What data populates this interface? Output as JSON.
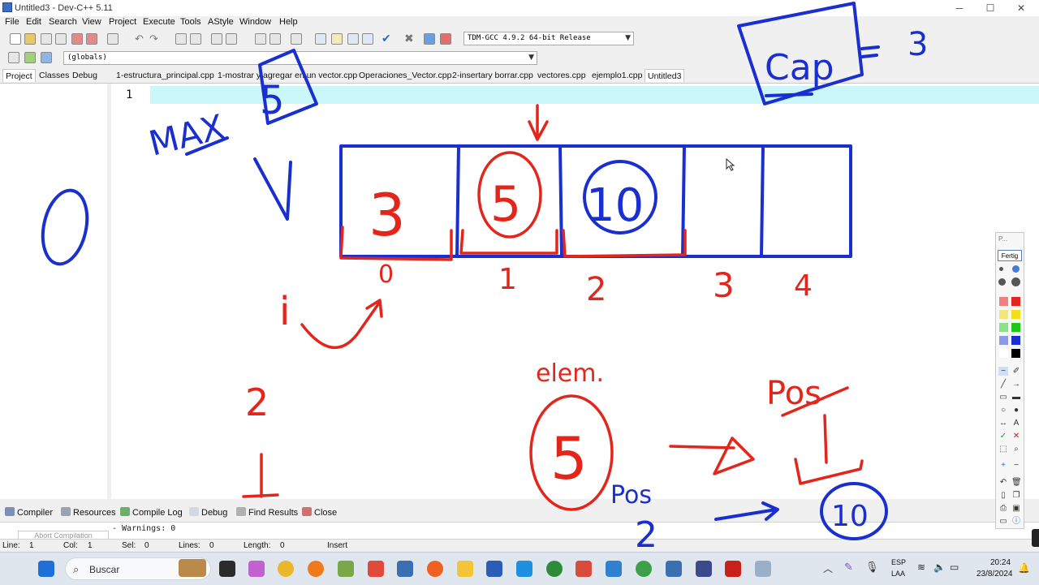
{
  "window": {
    "title": "Untitled3 - Dev-C++ 5.11",
    "minimize": "─",
    "maximize": "☐",
    "close": "✕"
  },
  "menu": [
    "File",
    "Edit",
    "Search",
    "View",
    "Project",
    "Execute",
    "Tools",
    "AStyle",
    "Window",
    "Help"
  ],
  "toolbar": {
    "compiler_select": "TDM-GCC 4.9.2 64-bit Release",
    "scope_select": "(globals)"
  },
  "panel_tabs": [
    "Project",
    "Classes",
    "Debug"
  ],
  "file_tabs": [
    "1-estructura_principal.cpp",
    "1-mostrar y agregar en un vector.cpp",
    "Operaciones_Vector.cpp",
    "2-insertary borrar.cpp",
    "vectores.cpp",
    "ejemplo1.cpp",
    "Untitled3"
  ],
  "active_file_tab": "Untitled3",
  "editor": {
    "line_number": "1"
  },
  "bottom_tabs": [
    "Compiler",
    "Resources",
    "Compile Log",
    "Debug",
    "Find Results",
    "Close"
  ],
  "compile_log": {
    "warnings": "- Warnings: 0",
    "abort_button": "Abort Compilation"
  },
  "status": {
    "line": "Line:",
    "line_val": "1",
    "col": "Col:",
    "col_val": "1",
    "sel": "Sel:",
    "sel_val": "0",
    "lines": "Lines:",
    "lines_val": "0",
    "length": "Length:",
    "length_val": "0",
    "mode": "Insert"
  },
  "taskbar": {
    "search_label": "Buscar",
    "lang1": "ESP",
    "lang2": "LAA",
    "time": "20:24",
    "date": "23/8/2024"
  },
  "ink_palette": {
    "header": "P...",
    "done_button": "Fertig"
  },
  "annotation": {
    "max_label": "MAX",
    "max_value": "5",
    "cap_label": "Cap",
    "cap_value": "3",
    "vector_label": "V",
    "left_digit": "0",
    "cells": [
      "3",
      "5",
      "10",
      "",
      ""
    ],
    "indices": [
      "0",
      "1",
      "2",
      "3",
      "4"
    ],
    "i_label": "i",
    "elem_label": "elem.",
    "elem_value": "5",
    "pos_label": "Pos",
    "pos_value": "1",
    "pos2_label": "Pos",
    "pos2_value": "2",
    "result_value": "10",
    "left_two": "2",
    "left_one": "1"
  },
  "colors": {
    "ink_blue": "#1a2fd0",
    "ink_red": "#e3261c",
    "current_line": "#ccf7fa"
  }
}
